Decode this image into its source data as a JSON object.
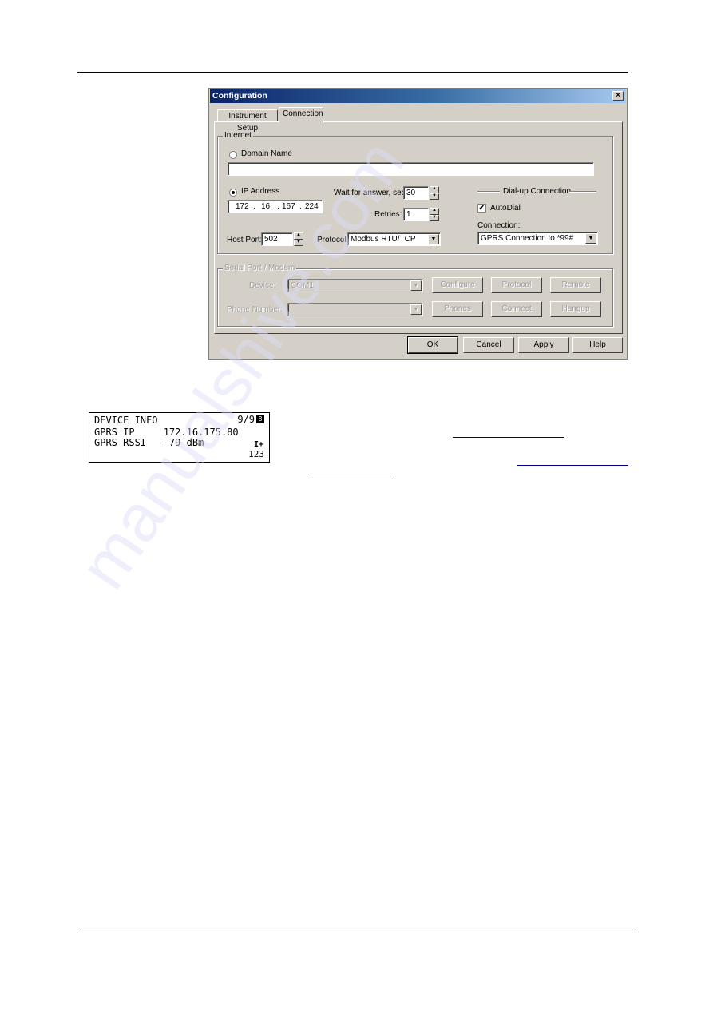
{
  "watermark": "manualshive.com",
  "dialog": {
    "title": "Configuration",
    "close_glyph": "×",
    "tabs": [
      {
        "label": "Instrument Setup",
        "active": false
      },
      {
        "label": "Connection",
        "active": true
      }
    ],
    "internet": {
      "group_label": "Internet",
      "domain_name": {
        "label": "Domain Name",
        "selected": false,
        "value": ""
      },
      "ip_address": {
        "label": "IP Address",
        "selected": true,
        "octets": [
          "172",
          "16",
          "167",
          "224"
        ],
        "dot": "."
      },
      "host_port": {
        "label": "Host Port:",
        "value": "502"
      },
      "wait_for_answer": {
        "label": "Wait for answer, sec:",
        "value": "30"
      },
      "retries": {
        "label": "Retries:",
        "value": "1"
      },
      "protocol": {
        "label": "Protocol:",
        "value": "Modbus RTU/TCP"
      },
      "dialup": {
        "label": "Dial-up Connection",
        "autodial": {
          "label": "AutoDial",
          "checked": true,
          "glyph": "✓"
        },
        "connection_label": "Connection:",
        "connection_value": "GPRS Connection to *99#"
      }
    },
    "serial": {
      "group_label": "Serial Port / Modem",
      "device_label": "Device:",
      "device_value": "COM1",
      "phone_label": "Phone Number:",
      "phone_value": "",
      "buttons": [
        "Configure",
        "Protocol",
        "Remote",
        "Phones",
        "Connect",
        "Hangup"
      ]
    },
    "footer_buttons": {
      "ok": "OK",
      "cancel": "Cancel",
      "apply": "Apply",
      "help": "Help"
    },
    "icons": {
      "spin_up": "▲",
      "spin_down": "▼",
      "dropdown": "▼"
    }
  },
  "lcd": {
    "title": "DEVICE INFO",
    "page": "9/9",
    "page_icon": "8",
    "line1": "GPRS IP     172.16.175.80",
    "line2": "GPRS RSSI   -79 dBm",
    "signal": "I+",
    "number": "123"
  }
}
